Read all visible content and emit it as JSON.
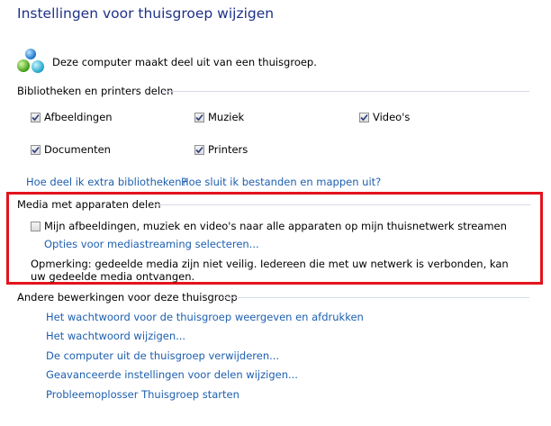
{
  "page": {
    "title": "Instellingen voor thuisgroep wijzigen",
    "member_text": "Deze computer maakt deel uit van een thuisgroep."
  },
  "sharing": {
    "heading": "Bibliotheken en printers delen",
    "items": [
      {
        "label": "Afbeeldingen",
        "checked": true
      },
      {
        "label": "Muziek",
        "checked": true
      },
      {
        "label": "Video's",
        "checked": true
      },
      {
        "label": "Documenten",
        "checked": true
      },
      {
        "label": "Printers",
        "checked": true
      }
    ],
    "links": [
      "Hoe deel ik extra bibliotheken?",
      "Hoe sluit ik bestanden en mappen uit?"
    ]
  },
  "media": {
    "heading": "Media met apparaten delen",
    "stream_label": "Mijn afbeeldingen, muziek en video's naar alle apparaten op mijn thuisnetwerk streamen",
    "stream_checked": false,
    "options_link": "Opties voor mediastreaming selecteren...",
    "note": "Opmerking: gedeelde media zijn niet veilig. Iedereen die met uw netwerk is verbonden, kan uw gedeelde media ontvangen."
  },
  "other": {
    "heading": "Andere bewerkingen voor deze thuisgroep",
    "links": [
      "Het wachtwoord voor de thuisgroep weergeven en afdrukken",
      "Het wachtwoord wijzigen...",
      "De computer uit de thuisgroep verwijderen...",
      "Geavanceerde instellingen voor delen wijzigen...",
      "Probleemoplosser Thuisgroep starten"
    ]
  },
  "colors": {
    "title": "#1e3287",
    "link": "#1d5fb0",
    "highlight": "#e3131d"
  },
  "icons": {
    "homegroup": "homegroup-icon",
    "checkmark": "checkmark-icon"
  }
}
